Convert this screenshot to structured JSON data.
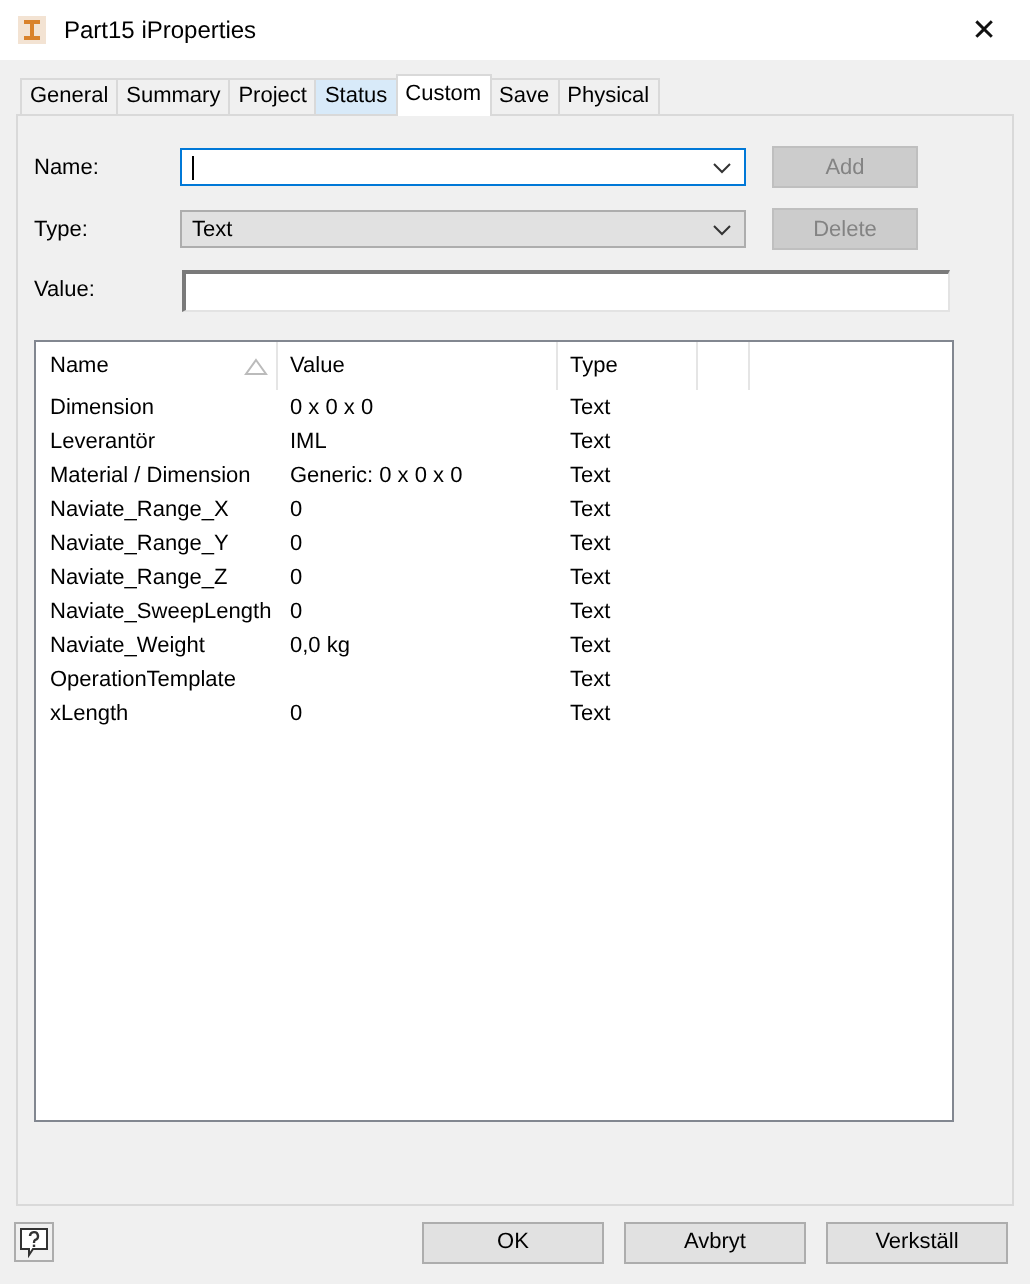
{
  "window": {
    "title": "Part15 iProperties",
    "close": "✕"
  },
  "tabs": [
    {
      "label": "General",
      "selected": false,
      "hovered": false
    },
    {
      "label": "Summary",
      "selected": false,
      "hovered": false
    },
    {
      "label": "Project",
      "selected": false,
      "hovered": false
    },
    {
      "label": "Status",
      "selected": false,
      "hovered": true
    },
    {
      "label": "Custom",
      "selected": true,
      "hovered": false
    },
    {
      "label": "Save",
      "selected": false,
      "hovered": false
    },
    {
      "label": "Physical",
      "selected": false,
      "hovered": false
    }
  ],
  "form": {
    "name_label": "Name:",
    "name_focused": true,
    "type_label": "Type:",
    "type_value": "Text",
    "value_label": "Value:",
    "add_button": {
      "label": "Add",
      "disabled": true
    },
    "delete_button": {
      "label": "Delete",
      "disabled": true
    }
  },
  "table": {
    "columns": [
      {
        "label": "Name",
        "sorted": true
      },
      {
        "label": "Value",
        "sorted": false
      },
      {
        "label": "Type",
        "sorted": false
      }
    ],
    "rows": [
      [
        "Dimension",
        "0 x 0 x 0",
        "Text"
      ],
      [
        "Leverantör",
        "IML",
        "Text"
      ],
      [
        "Material / Dimension",
        "Generic: 0 x 0 x 0",
        "Text"
      ],
      [
        "Naviate_Range_X",
        "0",
        "Text"
      ],
      [
        "Naviate_Range_Y",
        "0",
        "Text"
      ],
      [
        "Naviate_Range_Z",
        "0",
        "Text"
      ],
      [
        "Naviate_SweepLength",
        "0",
        "Text"
      ],
      [
        "Naviate_Weight",
        "0,0 kg",
        "Text"
      ],
      [
        "OperationTemplate",
        "",
        "Text"
      ],
      [
        "xLength",
        "0",
        "Text"
      ]
    ]
  },
  "buttons": [
    "OK",
    "Avbryt",
    "Verkställ"
  ]
}
